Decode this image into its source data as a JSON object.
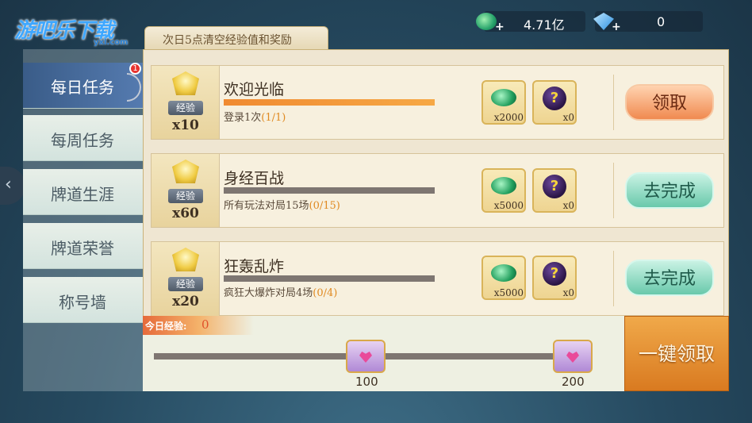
{
  "header": {
    "logo": "游吧乐下载",
    "logo_sub": "yxl.com",
    "notice": "次日5点清空经验值和奖励",
    "currency1_value": "4.71亿",
    "currency2_value": "0",
    "plus": "+"
  },
  "sidebar": {
    "items": [
      {
        "label": "每日任务",
        "active": true
      },
      {
        "label": "每周任务"
      },
      {
        "label": "牌道生涯"
      },
      {
        "label": "牌道荣誉"
      },
      {
        "label": "称号墙"
      }
    ],
    "badge": "1"
  },
  "tasks": [
    {
      "exp_tag": "经验",
      "exp": "x10",
      "title": "欢迎光临",
      "desc": "登录1次",
      "count": "(1/1)",
      "progress": 1.0,
      "reward1": "x2000",
      "reward2": "x0",
      "action": "领取",
      "action_type": "claim"
    },
    {
      "exp_tag": "经验",
      "exp": "x60",
      "title": "身经百战",
      "desc": "所有玩法对局15场",
      "count": "(0/15)",
      "progress": 0.0,
      "reward1": "x5000",
      "reward2": "x0",
      "action": "去完成",
      "action_type": "go"
    },
    {
      "exp_tag": "经验",
      "exp": "x20",
      "title": "狂轰乱炸",
      "desc": "疯狂大爆炸对局4场",
      "count": "(0/4)",
      "progress": 0.0,
      "reward1": "x5000",
      "reward2": "x0",
      "action": "去完成",
      "action_type": "go"
    }
  ],
  "reward_icon2": "?",
  "bottom": {
    "today_label": "今日经验:",
    "today_value": "0",
    "milestone1": "100",
    "milestone2": "200",
    "claim_all": "一键领取"
  },
  "colors": {
    "accent_orange": "#f08a30",
    "claim_button": "#f08a50",
    "go_button": "#69c9ab",
    "panel_bg": "#efe6d2"
  }
}
